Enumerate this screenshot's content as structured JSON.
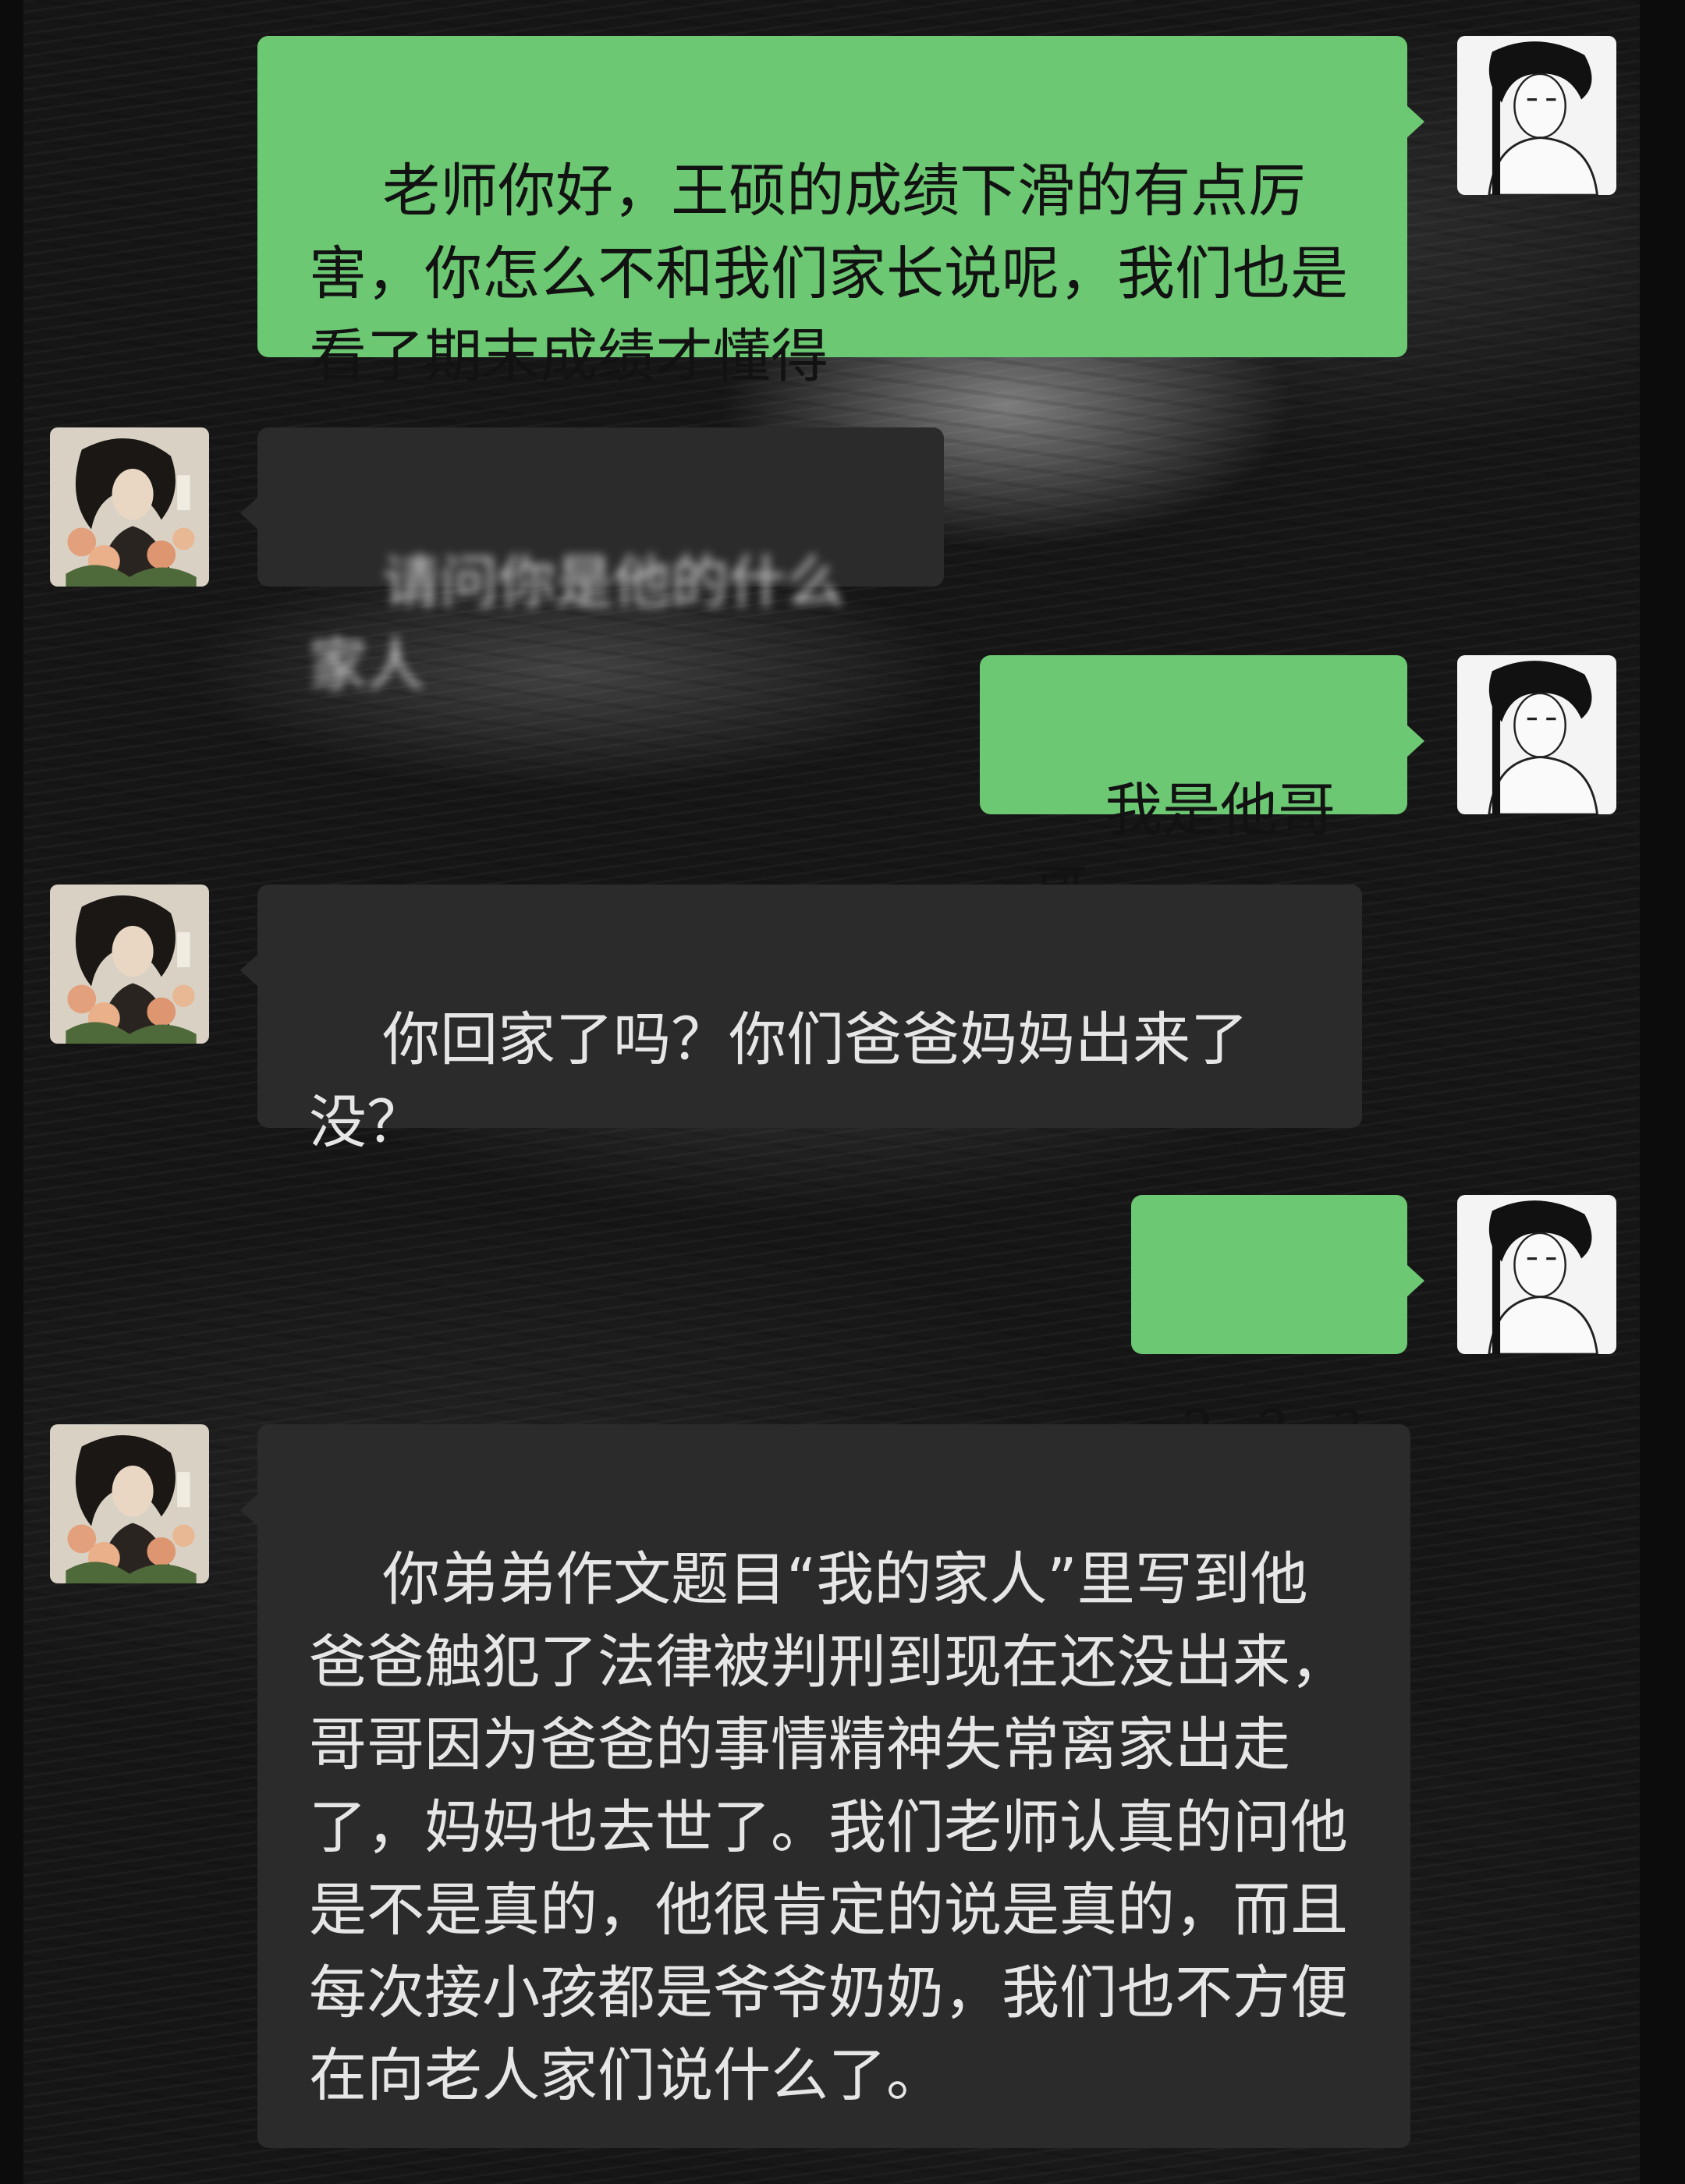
{
  "conversation": {
    "messages": [
      {
        "sender": "me",
        "avatar": "bw-sketch-boy-avatar",
        "text": "老师你好，王硕的成绩下滑的有点厉害，你怎么不和我们家长说呢，我们也是看了期末成绩才懂得"
      },
      {
        "sender": "teacher",
        "avatar": "woman-flowers-avatar",
        "text": "请问你是他的什么家人",
        "obscured": true
      },
      {
        "sender": "me",
        "avatar": "bw-sketch-boy-avatar",
        "text": "我是他哥哥"
      },
      {
        "sender": "teacher",
        "avatar": "woman-flowers-avatar",
        "text": "你回家了吗？你们爸爸妈妈出来了没？"
      },
      {
        "sender": "me",
        "avatar": "bw-sketch-boy-avatar",
        "text": "？？？"
      },
      {
        "sender": "teacher",
        "avatar": "woman-flowers-avatar",
        "text": "你弟弟作文题目“我的家人”里写到他爸爸触犯了法律被判刑到现在还没出来，哥哥因为爸爸的事情精神失常离家出走了，妈妈也去世了。我们老师认真的问他是不是真的，他很肯定的说是真的，而且每次接小孩都是爷爷奶奶，我们也不方便在向老人家们说什么了。"
      }
    ]
  },
  "colors": {
    "sent_bubble": "#6cc872",
    "received_bubble": "#2b2b2b",
    "background": "#161616"
  }
}
